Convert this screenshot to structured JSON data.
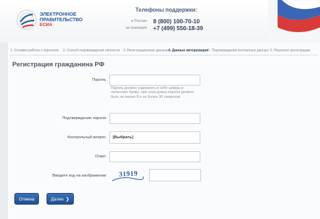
{
  "header": {
    "logo": {
      "line1": "ЭЛЕКТРОННОЕ",
      "line2": "ПРАВИТЕЛЬСТВО",
      "line3": "ЕСИА"
    },
    "support_title": "Телефоны поддержки:",
    "phones": [
      {
        "location": "в России:",
        "number": "8 (800) 100-70-10"
      },
      {
        "location": "за границей:",
        "number": "+7 (499) 550-18-39"
      }
    ]
  },
  "steps": [
    {
      "label": "1. Условия работы с порталом",
      "active": false
    },
    {
      "label": "2. Способ подтверждения личности",
      "active": false
    },
    {
      "label": "3. Регистрационные данные",
      "active": false
    },
    {
      "label": "4. Данные авторизации",
      "active": true
    },
    {
      "label": "5. Подтверждение контактных данных",
      "active": false
    },
    {
      "label": "6. Результат регистрации",
      "active": false
    }
  ],
  "form": {
    "title": "Регистрация гражданина РФ",
    "password_label": "Пароль",
    "password_hint": "Пароль должен содержать в себе цифры и латинские буквы, при этом длина пароля должна быть не менее 8 и не более 30 символов",
    "confirm_label": "Подтверждение пароля",
    "question_label": "Контрольный вопрос",
    "question_value": "[Выбрать]",
    "answer_label": "Ответ",
    "captcha_label": "Введите код на изображении",
    "captcha_code": "31919"
  },
  "buttons": {
    "cancel": "Отмена",
    "next": "Далее"
  },
  "colors": {
    "brand_blue": "#2b5c9e",
    "brand_red": "#d62a2a",
    "button_blue": "#2a5ea3"
  },
  "icons": {
    "logo": "gosuslugi-emblem-icon",
    "next": "chevron-right-icon",
    "flag": "russian-flag-icon"
  }
}
